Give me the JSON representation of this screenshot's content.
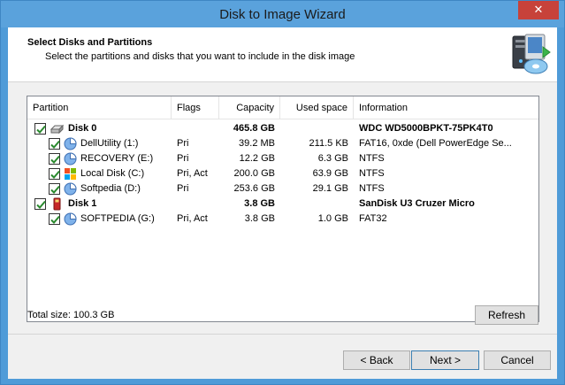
{
  "window": {
    "title": "Disk to Image Wizard",
    "close_label": "✕"
  },
  "header": {
    "title": "Select Disks and Partitions",
    "subtitle": "Select the partitions and disks that you want to include in the disk image",
    "icon": "computer-disk-icon"
  },
  "columns": {
    "partition": "Partition",
    "flags": "Flags",
    "capacity": "Capacity",
    "used": "Used space",
    "info": "Information"
  },
  "rows": [
    {
      "type": "disk",
      "name": "Disk 0",
      "flags": "",
      "capacity": "465.8 GB",
      "used": "",
      "info": "WDC WD5000BPKT-75PK4T0",
      "checked": true,
      "icon": "hard-disk-icon"
    },
    {
      "type": "partition",
      "name": "DellUtility (1:)",
      "flags": "Pri",
      "capacity": "39.2 MB",
      "used": "211.5 KB",
      "info": "FAT16, 0xde (Dell PowerEdge Se...",
      "checked": true,
      "icon": "partition-icon"
    },
    {
      "type": "partition",
      "name": "RECOVERY (E:)",
      "flags": "Pri",
      "capacity": "12.2 GB",
      "used": "6.3 GB",
      "info": "NTFS",
      "checked": true,
      "icon": "partition-icon"
    },
    {
      "type": "partition",
      "name": "Local Disk (C:)",
      "flags": "Pri, Act",
      "capacity": "200.0 GB",
      "used": "63.9 GB",
      "info": "NTFS",
      "checked": true,
      "icon": "windows-partition-icon"
    },
    {
      "type": "partition",
      "name": "Softpedia (D:)",
      "flags": "Pri",
      "capacity": "253.6 GB",
      "used": "29.1 GB",
      "info": "NTFS",
      "checked": true,
      "icon": "partition-icon"
    },
    {
      "type": "disk",
      "name": "Disk 1",
      "flags": "",
      "capacity": "3.8 GB",
      "used": "",
      "info": "SanDisk U3 Cruzer Micro",
      "checked": true,
      "icon": "usb-disk-icon"
    },
    {
      "type": "partition",
      "name": "SOFTPEDIA (G:)",
      "flags": "Pri, Act",
      "capacity": "3.8 GB",
      "used": "1.0 GB",
      "info": "FAT32",
      "checked": true,
      "icon": "partition-icon"
    }
  ],
  "total": "Total size: 100.3 GB",
  "buttons": {
    "refresh": "Refresh",
    "back": "< Back",
    "next": "Next >",
    "cancel": "Cancel"
  }
}
